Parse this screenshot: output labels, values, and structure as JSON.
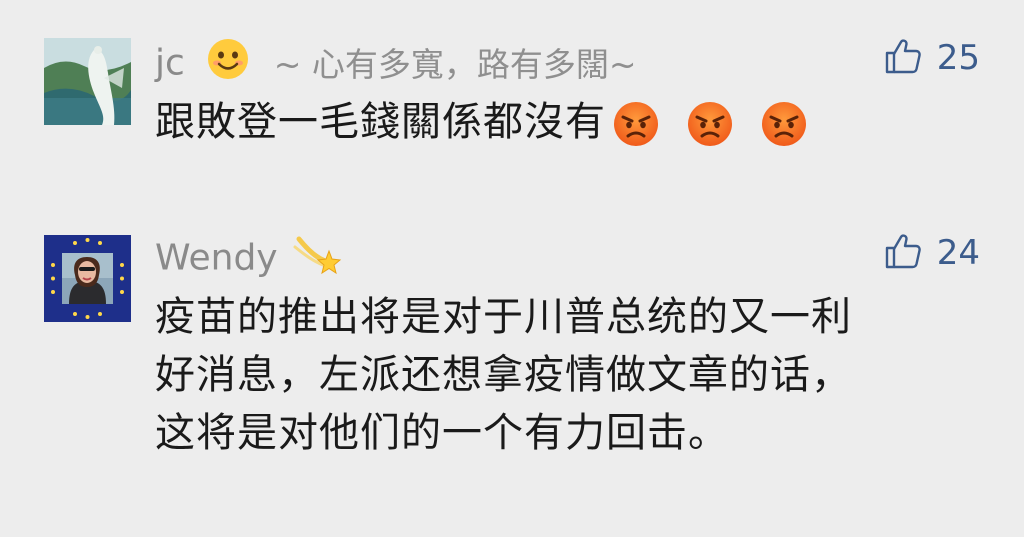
{
  "comments": [
    {
      "username": "jc",
      "username_emoji": "smiling-face-emoji",
      "signature": "~ 心有多寬，路有多闊~",
      "likes": "25",
      "text": "跟敗登一毛錢關係都沒有",
      "trailing_emojis": [
        "angry-face-emoji",
        "angry-face-emoji",
        "angry-face-emoji"
      ]
    },
    {
      "username": "Wendy",
      "username_emoji": "shooting-star-emoji",
      "likes": "24",
      "text_lines": [
        "疫苗的推出将是对于川普总统的又一利",
        "好消息，左派还想拿疫情做文章的话，",
        "这将是对他们的一个有力回击。"
      ]
    }
  ],
  "colors": {
    "background": "#ededed",
    "username": "#8a8a8a",
    "like_accent": "#3c5c8c",
    "body_text": "#1a1a1a"
  }
}
